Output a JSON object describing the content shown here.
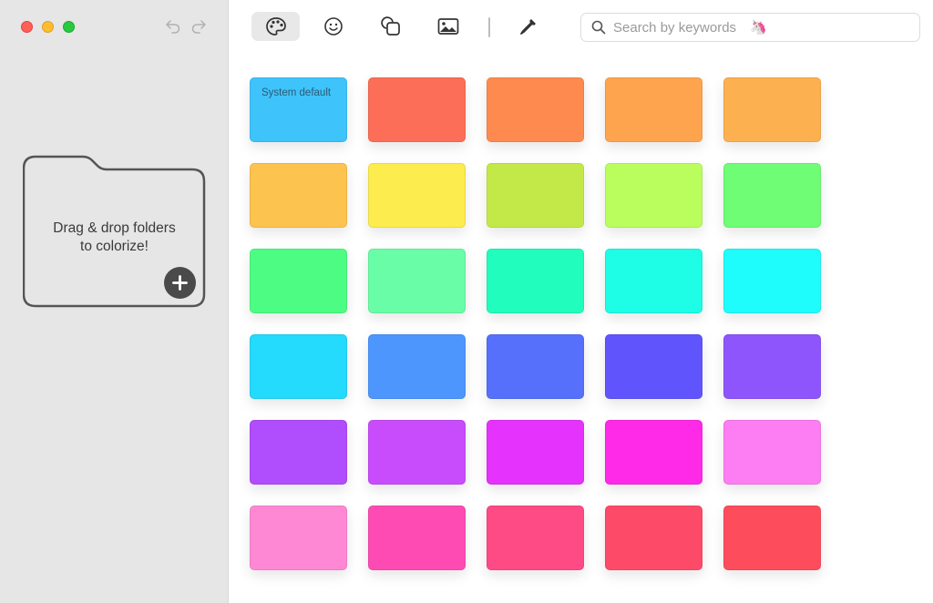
{
  "window": {
    "controls": [
      "close",
      "minimize",
      "maximize"
    ]
  },
  "sidebar": {
    "dropzone_text_line1": "Drag & drop folders",
    "dropzone_text_line2": "to colorize!"
  },
  "toolbar": {
    "tools": [
      {
        "name": "palette-icon",
        "active": true
      },
      {
        "name": "emoji-icon",
        "active": false
      },
      {
        "name": "shapes-icon",
        "active": false
      },
      {
        "name": "image-icon",
        "active": false
      },
      {
        "name": "eyedropper-icon",
        "active": false
      }
    ],
    "search_placeholder": "Search by keywords",
    "search_emoji": "🦄"
  },
  "swatches": {
    "system_default_label": "System default",
    "colors": [
      [
        "#3ec3fb",
        "#fd6e58",
        "#fe8a50",
        "#fea44f",
        "#fdb04f"
      ],
      [
        "#fdc34f",
        "#fcec4d",
        "#c3e948",
        "#b9fe5d",
        "#6ffd75"
      ],
      [
        "#4dfd83",
        "#68fda6",
        "#20fdbd",
        "#1efde5",
        "#1efdfb"
      ],
      [
        "#24dafd",
        "#4d96fe",
        "#5670fc",
        "#6055fd",
        "#8f55fd"
      ],
      [
        "#b04dfc",
        "#c84cfc",
        "#e532fc",
        "#fe2ae8",
        "#fd7df2"
      ],
      [
        "#fe88d3",
        "#fe4bb3",
        "#fe4a85",
        "#fe4a69",
        "#fd4d5c"
      ]
    ]
  }
}
